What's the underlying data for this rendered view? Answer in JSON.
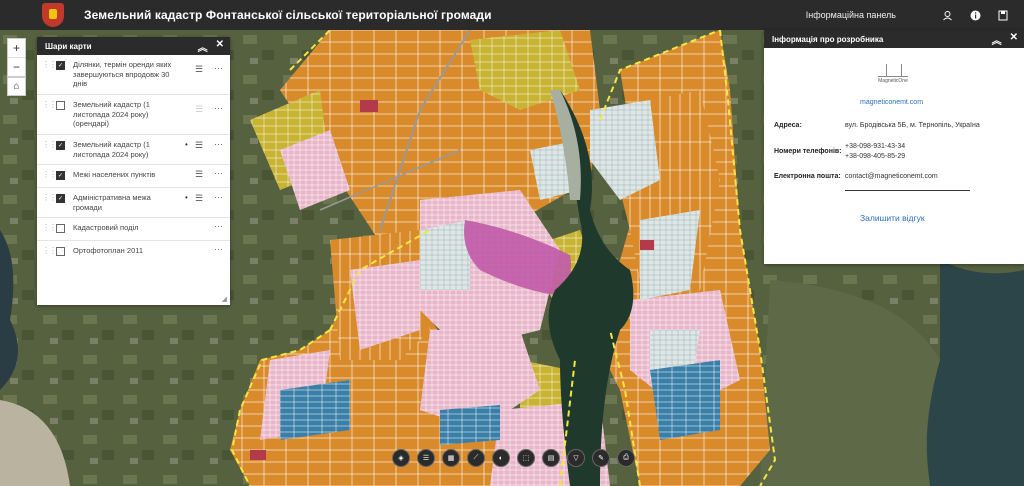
{
  "header": {
    "title": "Земельний кадастр Фонтанської сільської територіальної громади",
    "info_panel_link": "Інформаційна панель",
    "icons": [
      "user-icon",
      "info-icon",
      "bookmark-icon"
    ]
  },
  "map_controls": {
    "zoom_in": "+",
    "zoom_out": "−",
    "home": "⌂"
  },
  "layers_panel": {
    "title": "Шари карти",
    "layers": [
      {
        "label": "Ділянки, термін оренди яких завершуються впродовж 30 днів",
        "checked": true
      },
      {
        "label": "Земельний кадастр (1 листопада 2024 року) (орендарі)",
        "checked": false
      },
      {
        "label": "Земельний кадастр (1 листопада 2024 року)",
        "checked": true
      },
      {
        "label": "Межі населених пунктів",
        "checked": true
      },
      {
        "label": "Адміністративна межа громади",
        "checked": true
      },
      {
        "label": "Кадастровий поділ",
        "checked": false
      },
      {
        "label": "Ортофотоплан 2011",
        "checked": false
      }
    ]
  },
  "info_panel": {
    "title": "Інформація про розробника",
    "brand": "MagneticOne",
    "website": "magneticonemt.com",
    "address_label": "Адреса:",
    "address_value": "вул. Бродівська 5Б, м. Тернопіль, Україна",
    "phones_label": "Номери телефонів:",
    "phone_1": "+38-098-931-43-34",
    "phone_2": "+38-098-405-85-29",
    "email_label": "Електронна пошта:",
    "email_value": "contact@magneticonemt.com",
    "feedback": "Залишити відгук"
  },
  "colors": {
    "header_bg": "#2b2b2b",
    "parcel_orange": "#d98a2b",
    "parcel_yellow": "#c8b432",
    "parcel_pink": "#e8b6c8",
    "parcel_magenta": "#c05aa8",
    "boundary_yellow": "#f5e642",
    "water": "#1f3a2c",
    "link_blue": "#2a6fba"
  }
}
